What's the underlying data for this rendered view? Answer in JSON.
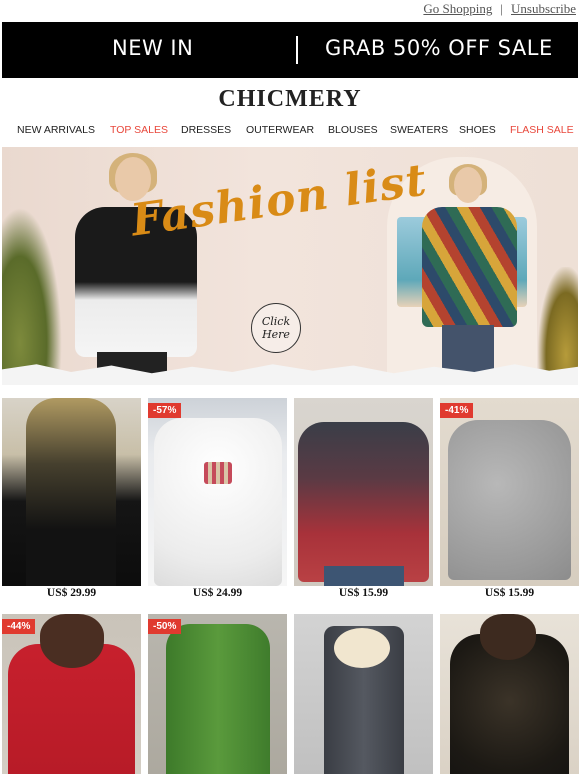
{
  "top_links": {
    "go_shopping": "Go Shopping",
    "separator": "|",
    "unsubscribe": "Unsubscribe"
  },
  "promo": {
    "left_text": "NEW IN",
    "right_text": "GRAB 50% OFF SALE",
    "background": "#000000"
  },
  "brand": "CHICMERY",
  "nav": {
    "items": [
      {
        "label": "NEW ARRIVALS",
        "highlight": false
      },
      {
        "label": "TOP SALES",
        "highlight": true
      },
      {
        "label": "DRESSES",
        "highlight": false
      },
      {
        "label": "OUTERWEAR",
        "highlight": false
      },
      {
        "label": "BLOUSES",
        "highlight": false
      },
      {
        "label": "SWEATERS",
        "highlight": false
      },
      {
        "label": "SHOES",
        "highlight": false
      },
      {
        "label": "FLASH SALE",
        "highlight": true
      }
    ],
    "highlight_color": "#e8473b"
  },
  "banner": {
    "script_text": "Fashion list",
    "button_text_1": "Click",
    "button_text_2": "Here"
  },
  "products": [
    {
      "price": "US$ 29.99",
      "badge": ""
    },
    {
      "price": "US$ 24.99",
      "badge": "-57%"
    },
    {
      "price": "US$ 15.99",
      "badge": ""
    },
    {
      "price": "US$ 15.99",
      "badge": "-41%"
    },
    {
      "price": "",
      "badge": "-44%"
    },
    {
      "price": "",
      "badge": "-50%"
    },
    {
      "price": "",
      "badge": ""
    },
    {
      "price": "",
      "badge": ""
    }
  ],
  "badge_color": "#e03a2f"
}
